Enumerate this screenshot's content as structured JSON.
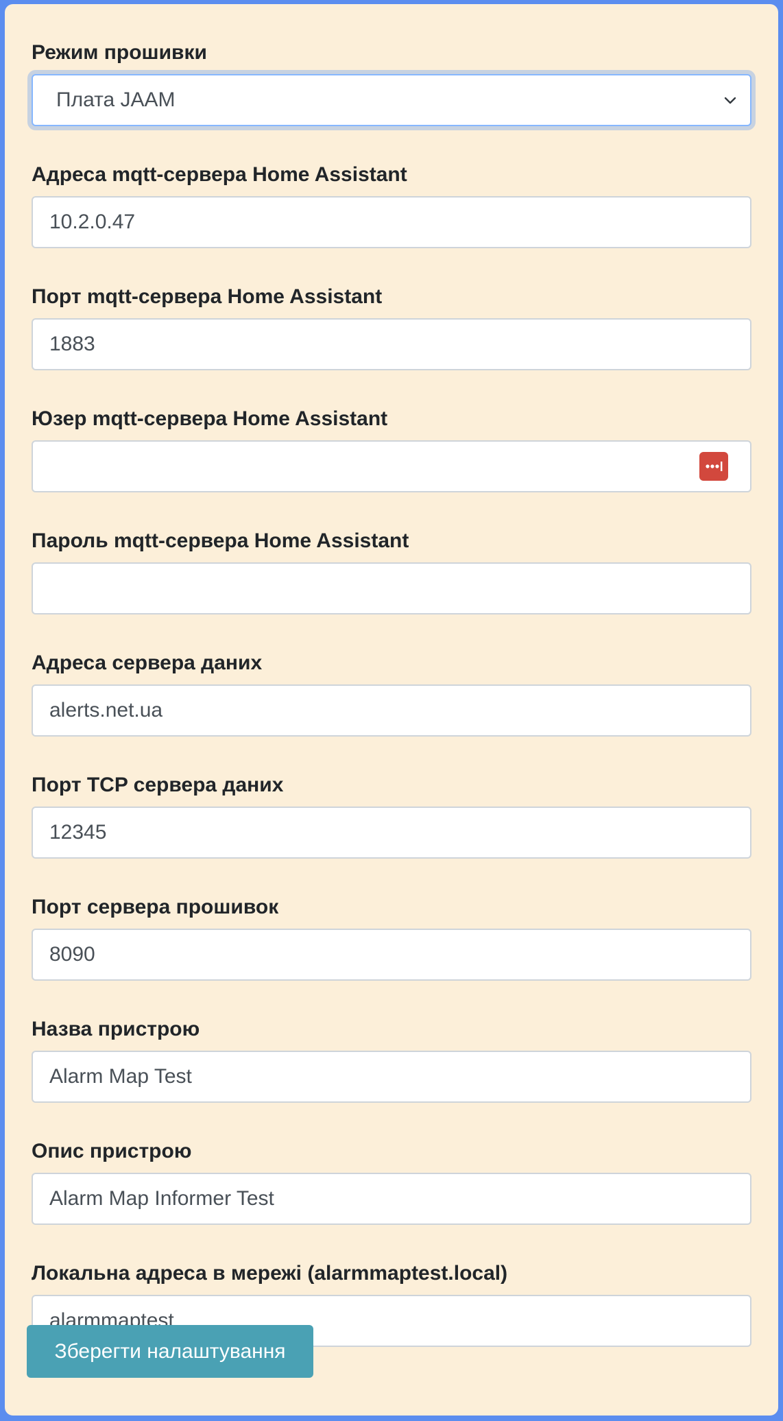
{
  "form": {
    "firmware_mode": {
      "label": "Режим прошивки",
      "selected": "Плата JAAM"
    },
    "fields": [
      {
        "label": "Адреса mqtt-сервера Home Assistant",
        "value": "10.2.0.47"
      },
      {
        "label": "Порт mqtt-сервера Home Assistant",
        "value": "1883"
      },
      {
        "label": "Юзер mqtt-сервера Home Assistant",
        "value": ""
      },
      {
        "label": "Пароль mqtt-сервера Home Assistant",
        "value": ""
      },
      {
        "label": "Адреса сервера даних",
        "value": "alerts.net.ua"
      },
      {
        "label": "Порт TCP сервера даних",
        "value": "12345"
      },
      {
        "label": "Порт сервера прошивок",
        "value": "8090"
      },
      {
        "label": "Назва пристрою",
        "value": "Alarm Map Test"
      },
      {
        "label": "Опис пристрою",
        "value": "Alarm Map Informer Test"
      },
      {
        "label": "Локальна адреса в мережі (alarmmaptest.local)",
        "value": "alarmmaptest"
      }
    ],
    "save_label": "Зберегти налаштування"
  },
  "icons": {
    "select_arrow": "chevron-down-icon",
    "password_manager": "password-manager-icon"
  },
  "colors": {
    "background": "#5b8def",
    "card": "#fcefd9",
    "button": "#4aa1b4",
    "password_icon": "#d2483d"
  }
}
